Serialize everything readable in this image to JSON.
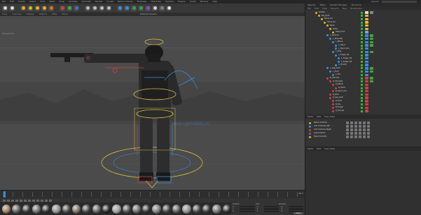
{
  "menubar": {
    "items": [
      "File",
      "Edit",
      "Create",
      "Select",
      "Tools",
      "Mesh",
      "Snap",
      "Animate",
      "Simulate",
      "Render",
      "Sculpt",
      "Motion Tracker",
      "MoGraph",
      "Character",
      "Pipeline",
      "Plugins",
      "Script",
      "Window",
      "Help"
    ],
    "layout_label": "Layout:"
  },
  "toolbar": {
    "icons": [
      {
        "name": "undo-icon",
        "color": "#d9d9d9"
      },
      {
        "name": "redo-icon",
        "color": "#d9d9d9"
      },
      {
        "name": "live-select-icon",
        "color": "#e0b020"
      },
      {
        "name": "move-icon",
        "color": "#e0b020"
      },
      {
        "name": "scale-icon",
        "color": "#e0b020"
      },
      {
        "name": "rotate-icon",
        "color": "#e0b020"
      },
      {
        "name": "recent-tool-icon",
        "color": "#e07020"
      },
      {
        "name": "x-axis-icon",
        "color": "#d04040"
      },
      {
        "name": "y-axis-icon",
        "color": "#40b040"
      },
      {
        "name": "z-axis-icon",
        "color": "#4070d0"
      },
      {
        "name": "coordinate-system-icon",
        "color": "#bbbbbb"
      },
      {
        "name": "render-view-icon",
        "color": "#bbbbbb"
      },
      {
        "name": "render-picture-viewer-icon",
        "color": "#bbbbbb"
      },
      {
        "name": "render-settings-icon",
        "color": "#bbbbbb"
      },
      {
        "name": "cube-icon",
        "color": "#3a8ee0"
      },
      {
        "name": "pen-icon",
        "color": "#3a8ee0"
      },
      {
        "name": "subdivision-icon",
        "color": "#3aa040"
      },
      {
        "name": "array-icon",
        "color": "#3aa040"
      },
      {
        "name": "bend-icon",
        "color": "#7e50d0"
      },
      {
        "name": "floor-icon",
        "color": "#d0d0d0"
      },
      {
        "name": "camera-icon",
        "color": "#7e7e7e"
      },
      {
        "name": "light-icon",
        "color": "#e0e0e0"
      }
    ]
  },
  "viewport": {
    "menu": [
      "View",
      "Cameras",
      "Display",
      "Options",
      "Filter",
      "Panel"
    ],
    "label": "Perspective",
    "camera_title": "Default Camera"
  },
  "timeline": {
    "end_frame": "90 F"
  },
  "materials": {
    "swatches": [
      "#9a7a5a",
      "#555",
      "#333",
      "#6a6a6a",
      "#2b2b2b",
      "#888",
      "#444",
      "#7a6a5a",
      "#3a3a3a",
      "#5a5a5a",
      "#222",
      "#999",
      "#4a4a4a",
      "#666",
      "#2f2f2f",
      "#777",
      "#3d3d3d",
      "#555",
      "#8a8a8a",
      "#444",
      "#333",
      "#6d6d6d",
      "#2a2a2a"
    ]
  },
  "coords": {
    "headers": [
      "Position",
      "Size",
      "Rotation"
    ],
    "labels": [
      "X",
      "Y",
      "Z"
    ],
    "apply_label": "Apply"
  },
  "object_manager": {
    "tabs": [
      "Objects",
      "Takes",
      "Content Browser",
      "Structure"
    ],
    "menu": [
      "File",
      "Edit",
      "View",
      "Objects",
      "Tags",
      "Bookmarks"
    ],
    "rows": [
      {
        "name": "Soldier",
        "indent": 14,
        "color": "#e0b020",
        "tag": "#e0e0e0",
        "tag2": "#888"
      },
      {
        "name": "Rig_Root",
        "indent": 18,
        "color": "#e0b020",
        "tag": "#e6b830",
        "tag2": ""
      },
      {
        "name": "Spine_01",
        "indent": 22,
        "color": "#e0b020",
        "tag": "#e6b830",
        "tag2": ""
      },
      {
        "name": "Spine_02",
        "indent": 26,
        "color": "#e0b020",
        "tag": "#e6b830",
        "tag2": ""
      },
      {
        "name": "Neck",
        "indent": 30,
        "color": "#e0b020",
        "tag": "#e6b830",
        "tag2": ""
      },
      {
        "name": "Head",
        "indent": 34,
        "color": "#e0b020",
        "tag": "#e6b830",
        "tag2": ""
      },
      {
        "name": "Head_End",
        "indent": 38,
        "color": "#e0b020",
        "tag": "#6ab0e0",
        "tag2": ""
      },
      {
        "name": "L_Clavicle",
        "indent": 30,
        "color": "#3a8ee0",
        "tag": "#3a8ee0",
        "tag2": "#4aa040"
      },
      {
        "name": "L_Shoulder",
        "indent": 34,
        "color": "#3a8ee0",
        "tag": "#3a8ee0",
        "tag2": "#4aa040"
      },
      {
        "name": "L_Elbow",
        "indent": 38,
        "color": "#3a8ee0",
        "tag": "#3a8ee0",
        "tag2": "#4aa040"
      },
      {
        "name": "L_Hand",
        "indent": 42,
        "color": "#3a8ee0",
        "tag": "#3a8ee0",
        "tag2": "#4aa040"
      },
      {
        "name": "L_Hand_Con",
        "indent": 42,
        "color": "#3a8ee0",
        "tag": "#3a8ee0",
        "tag2": ""
      },
      {
        "name": "L_Pole",
        "indent": 38,
        "color": "#3a8ee0",
        "tag": "#3a8ee0",
        "tag2": "#4aa040"
      },
      {
        "name": "L_Finger_01",
        "indent": 42,
        "color": "#3a8ee0",
        "tag": "#3a8ee0",
        "tag2": ""
      },
      {
        "name": "L_Finger_02",
        "indent": 46,
        "color": "#3a8ee0",
        "tag": "#3a8ee0",
        "tag2": ""
      },
      {
        "name": "L_Finger_03",
        "indent": 46,
        "color": "#3a8ee0",
        "tag": "#3a8ee0",
        "tag2": ""
      },
      {
        "name": "L_Thumb",
        "indent": 42,
        "color": "#3a8ee0",
        "tag": "#3a8ee0",
        "tag2": ""
      },
      {
        "name": "L_Leg_Goal",
        "indent": 30,
        "color": "#3a8ee0",
        "tag": "#3a8ee0",
        "tag2": "#4aa040"
      },
      {
        "name": "L_Foot",
        "indent": 34,
        "color": "#3a8ee0",
        "tag": "#3a8ee0",
        "tag2": "#4aa040"
      },
      {
        "name": "L_Toe",
        "indent": 38,
        "color": "#3a8ee0",
        "tag": "#3a8ee0",
        "tag2": ""
      },
      {
        "name": "R_Clavicle",
        "indent": 30,
        "color": "#d04040",
        "tag": "#d04040",
        "tag2": "#4aa040"
      },
      {
        "name": "R_Shoulder",
        "indent": 34,
        "color": "#d04040",
        "tag": "#d04040",
        "tag2": "#4aa040"
      },
      {
        "name": "R_Elbow",
        "indent": 38,
        "color": "#d04040",
        "tag": "#d04040",
        "tag2": ""
      },
      {
        "name": "R_Hand",
        "indent": 42,
        "color": "#d04040",
        "tag": "#d04040",
        "tag2": ""
      },
      {
        "name": "R_Hand_Con",
        "indent": 38,
        "color": "#d04040",
        "tag": "#d04040",
        "tag2": ""
      },
      {
        "name": "R_Pole",
        "indent": 34,
        "color": "#d04040",
        "tag": "#d04040",
        "tag2": ""
      },
      {
        "name": "R_Leg_Goal",
        "indent": 34,
        "color": "#d04040",
        "tag": "#d04040",
        "tag2": ""
      },
      {
        "name": "R_Foot",
        "indent": 38,
        "color": "#d04040",
        "tag": "#d04040",
        "tag2": ""
      },
      {
        "name": "R_Toe",
        "indent": 38,
        "color": "#d04040",
        "tag": "#d04040",
        "tag2": ""
      },
      {
        "name": "R_Finger",
        "indent": 38,
        "color": "#d04040",
        "tag": "#d04040",
        "tag2": ""
      },
      {
        "name": "R_Thumb",
        "indent": 38,
        "color": "#d04040",
        "tag": "#d04040",
        "tag2": ""
      }
    ]
  },
  "tag_panel": {
    "menu": [
      "Mode",
      "Edit",
      "User Data"
    ],
    "rows": [
      {
        "name": "Spine Controls",
        "color": "#e0b020"
      },
      {
        "name": "Arm Controls Left",
        "color": "#3a8ee0"
      },
      {
        "name": "Arm Controls Right",
        "color": "#d04040"
      },
      {
        "name": "Leg Controls",
        "color": "#7e50d0"
      },
      {
        "name": "Head Controls",
        "color": "#e0b020"
      }
    ]
  },
  "attributes": {
    "menu": [
      "Mode",
      "Edit",
      "User Data"
    ]
  }
}
